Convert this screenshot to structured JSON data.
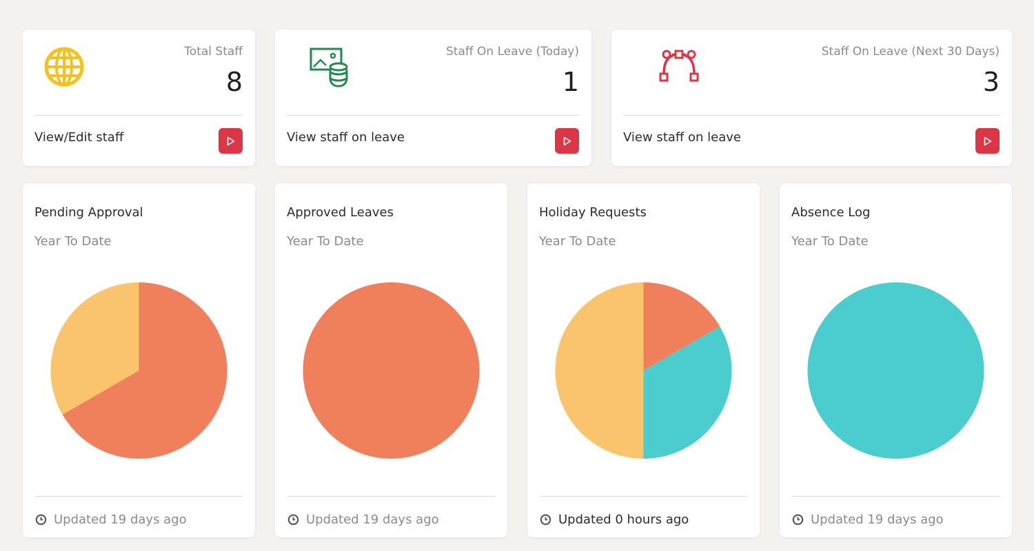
{
  "stats": [
    {
      "label": "Total Staff",
      "value": "8",
      "link": "View/Edit staff",
      "icon": "globe-icon",
      "icon_color": "#f5c21b"
    },
    {
      "label": "Staff On Leave (Today)",
      "value": "1",
      "link": "View staff on leave",
      "icon": "image-database-icon",
      "icon_color": "#1e8a4c"
    },
    {
      "label": "Staff On Leave (Next 30 Days)",
      "value": "3",
      "link": "View staff on leave",
      "icon": "bezier-curve-icon",
      "icon_color": "#dc3545"
    }
  ],
  "button_color": "#dc3545",
  "charts": [
    {
      "title": "Pending Approval",
      "subtitle": "Year To Date",
      "footer": "Updated 19 days ago",
      "chart_data": {
        "type": "pie",
        "values": [
          2,
          1
        ],
        "colors": [
          "#f0805c",
          "#f9c46b"
        ]
      }
    },
    {
      "title": "Approved Leaves",
      "subtitle": "Year To Date",
      "footer": "Updated 19 days ago",
      "chart_data": {
        "type": "pie",
        "values": [
          1
        ],
        "colors": [
          "#f0805c"
        ]
      }
    },
    {
      "title": "Holiday Requests",
      "subtitle": "Year To Date",
      "footer": "Updated 0 hours ago",
      "chart_data": {
        "type": "pie",
        "values": [
          1,
          2,
          3
        ],
        "colors": [
          "#f0805c",
          "#4bcccd",
          "#f9c46b"
        ]
      }
    },
    {
      "title": "Absence Log",
      "subtitle": "Year To Date",
      "footer": "Updated 19 days ago",
      "chart_data": {
        "type": "pie",
        "values": [
          1
        ],
        "colors": [
          "#4bcccd"
        ]
      }
    }
  ]
}
